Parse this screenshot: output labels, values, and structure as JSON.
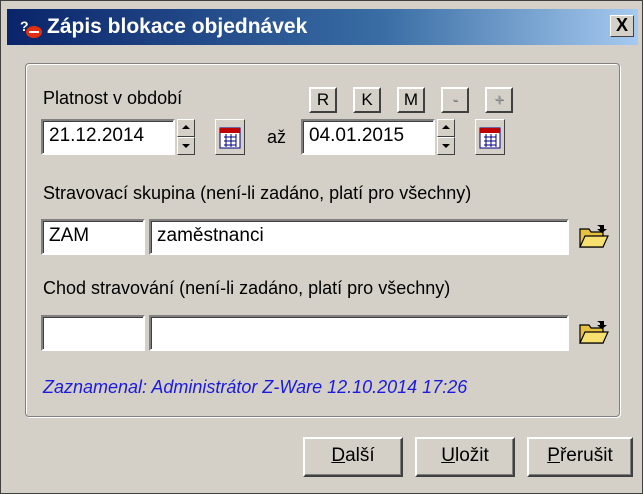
{
  "window": {
    "title": "Zápis blokace objednávek",
    "close_label": "X"
  },
  "period": {
    "label": "Platnost v období",
    "from": "21.12.2014",
    "to_label": "až",
    "to": "04.01.2015",
    "quick_buttons": [
      "R",
      "K",
      "M",
      "-",
      "+"
    ]
  },
  "group": {
    "label": "Stravovací skupina (není-li zadáno, platí pro všechny)",
    "code": "ZAM",
    "name": "zaměstnanci"
  },
  "course": {
    "label": "Chod stravování (není-li zadáno, platí pro všechny)",
    "code": "",
    "name": ""
  },
  "recorded": "Zaznamenal: Administrátor Z-Ware 12.10.2014 17:26",
  "buttons": {
    "next_prefix": "D",
    "next_rest": "alší",
    "save_prefix": "U",
    "save_rest": "ložit",
    "cancel_prefix": "P",
    "cancel_rest": "řerušit"
  },
  "icons": {
    "title": "app-icon",
    "calendar": "calendar-icon",
    "folder": "folder-open-icon"
  }
}
